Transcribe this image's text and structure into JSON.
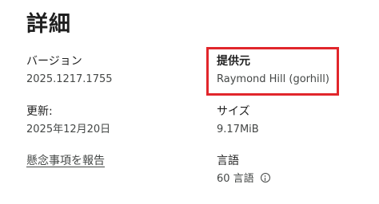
{
  "section": {
    "title": "詳細"
  },
  "details": {
    "version": {
      "label": "バージョン",
      "value": "2025.1217.1755"
    },
    "provider": {
      "label": "提供元",
      "value": "Raymond Hill (gorhill)"
    },
    "updated": {
      "label": "更新:",
      "value": "2025年12月20日"
    },
    "size": {
      "label": "サイズ",
      "value": "9.17MiB"
    },
    "report_link": "懸念事項を報告",
    "languages": {
      "label": "言語",
      "value": "60 言語"
    }
  },
  "annotation": {
    "highlight_color": "#e1262b"
  },
  "icons": {
    "languages_info": "info-icon"
  }
}
